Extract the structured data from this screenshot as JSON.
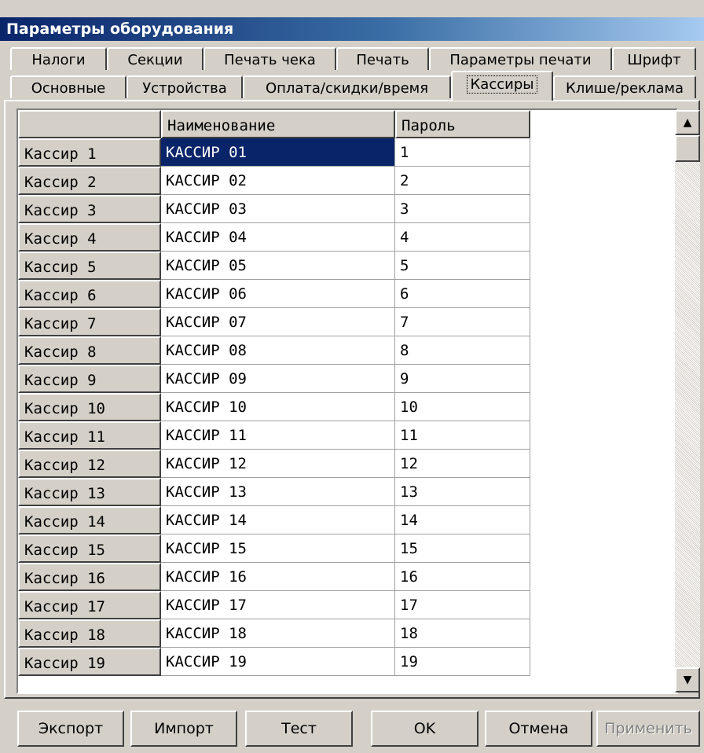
{
  "window": {
    "title": "Параметры оборудования"
  },
  "tabs": {
    "row1": [
      "Налоги",
      "Секции",
      "Печать чека",
      "Печать",
      "Параметры печати",
      "Шрифт"
    ],
    "row2": [
      "Основные",
      "Устройства",
      "Оплата/скидки/время",
      "Кассиры",
      "Клише/реклама"
    ],
    "active": "Кассиры"
  },
  "grid": {
    "columns": [
      "",
      "Наименование",
      "Пароль"
    ],
    "rows": [
      {
        "label": "Кассир 1",
        "name": "КАССИР 01",
        "password": "1"
      },
      {
        "label": "Кассир 2",
        "name": "КАССИР 02",
        "password": "2"
      },
      {
        "label": "Кассир 3",
        "name": "КАССИР 03",
        "password": "3"
      },
      {
        "label": "Кассир 4",
        "name": "КАССИР 04",
        "password": "4"
      },
      {
        "label": "Кассир 5",
        "name": "КАССИР 05",
        "password": "5"
      },
      {
        "label": "Кассир 6",
        "name": "КАССИР 06",
        "password": "6"
      },
      {
        "label": "Кассир 7",
        "name": "КАССИР 07",
        "password": "7"
      },
      {
        "label": "Кассир 8",
        "name": "КАССИР 08",
        "password": "8"
      },
      {
        "label": "Кассир 9",
        "name": "КАССИР 09",
        "password": "9"
      },
      {
        "label": "Кассир 10",
        "name": "КАССИР 10",
        "password": "10"
      },
      {
        "label": "Кассир 11",
        "name": "КАССИР 11",
        "password": "11"
      },
      {
        "label": "Кассир 12",
        "name": "КАССИР 12",
        "password": "12"
      },
      {
        "label": "Кассир 13",
        "name": "КАССИР 13",
        "password": "13"
      },
      {
        "label": "Кассир 14",
        "name": "КАССИР 14",
        "password": "14"
      },
      {
        "label": "Кассир 15",
        "name": "КАССИР 15",
        "password": "15"
      },
      {
        "label": "Кассир 16",
        "name": "КАССИР 16",
        "password": "16"
      },
      {
        "label": "Кассир 17",
        "name": "КАССИР 17",
        "password": "17"
      },
      {
        "label": "Кассир 18",
        "name": "КАССИР 18",
        "password": "18"
      },
      {
        "label": "Кассир 19",
        "name": "КАССИР 19",
        "password": "19"
      }
    ],
    "selected_row": 0
  },
  "scrollbar": {
    "up_icon": "arrow-up-icon",
    "down_icon": "arrow-down-icon"
  },
  "buttons": {
    "export": "Экспорт",
    "import": "Импорт",
    "test": "Тест",
    "ok": "OK",
    "cancel": "Отмена",
    "apply": "Применить"
  },
  "colors": {
    "title_gradient_start": "#0a246a",
    "title_gradient_end": "#a6caf0",
    "selection": "#0a246a",
    "face": "#d4d0c8"
  }
}
